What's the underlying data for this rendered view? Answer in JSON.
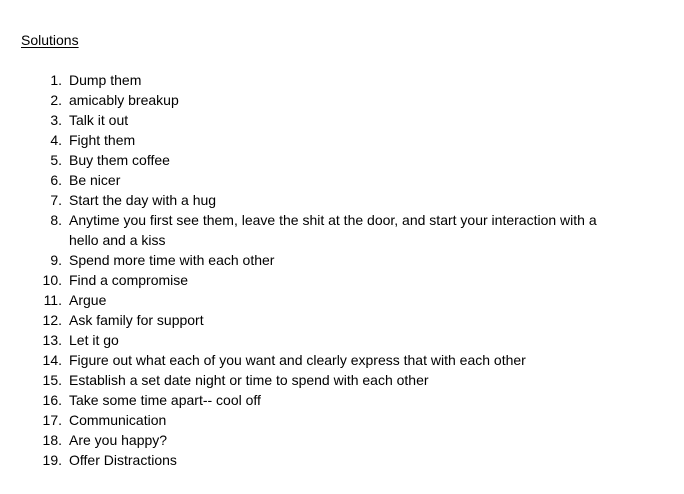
{
  "document": {
    "heading": "Solutions",
    "items": [
      {
        "number": "1.",
        "text": "Dump them"
      },
      {
        "number": "2.",
        "text": "amicably breakup"
      },
      {
        "number": "3.",
        "text": "Talk it out"
      },
      {
        "number": "4.",
        "text": "Fight them"
      },
      {
        "number": "5.",
        "text": "Buy them coffee"
      },
      {
        "number": "6.",
        "text": "Be nicer"
      },
      {
        "number": "7.",
        "text": "Start the day with a hug"
      },
      {
        "number": "8.",
        "text": "Anytime you first see them, leave the shit at the door, and start your interaction with a hello and a kiss"
      },
      {
        "number": "9.",
        "text": "Spend more time with each other"
      },
      {
        "number": "10.",
        "text": "Find a compromise"
      },
      {
        "number": "11.",
        "text": "Argue"
      },
      {
        "number": "12.",
        "text": "Ask family for support"
      },
      {
        "number": "13.",
        "text": "Let it go"
      },
      {
        "number": "14.",
        "text": "Figure out what each of you want and clearly express that with each other"
      },
      {
        "number": "15.",
        "text": "Establish a set date night or time to spend with each other"
      },
      {
        "number": "16.",
        "text": "Take some time apart-- cool off"
      },
      {
        "number": "17.",
        "text": "Communication"
      },
      {
        "number": "18.",
        "text": "Are you happy?"
      },
      {
        "number": "19.",
        "text": "Offer Distractions"
      }
    ]
  }
}
